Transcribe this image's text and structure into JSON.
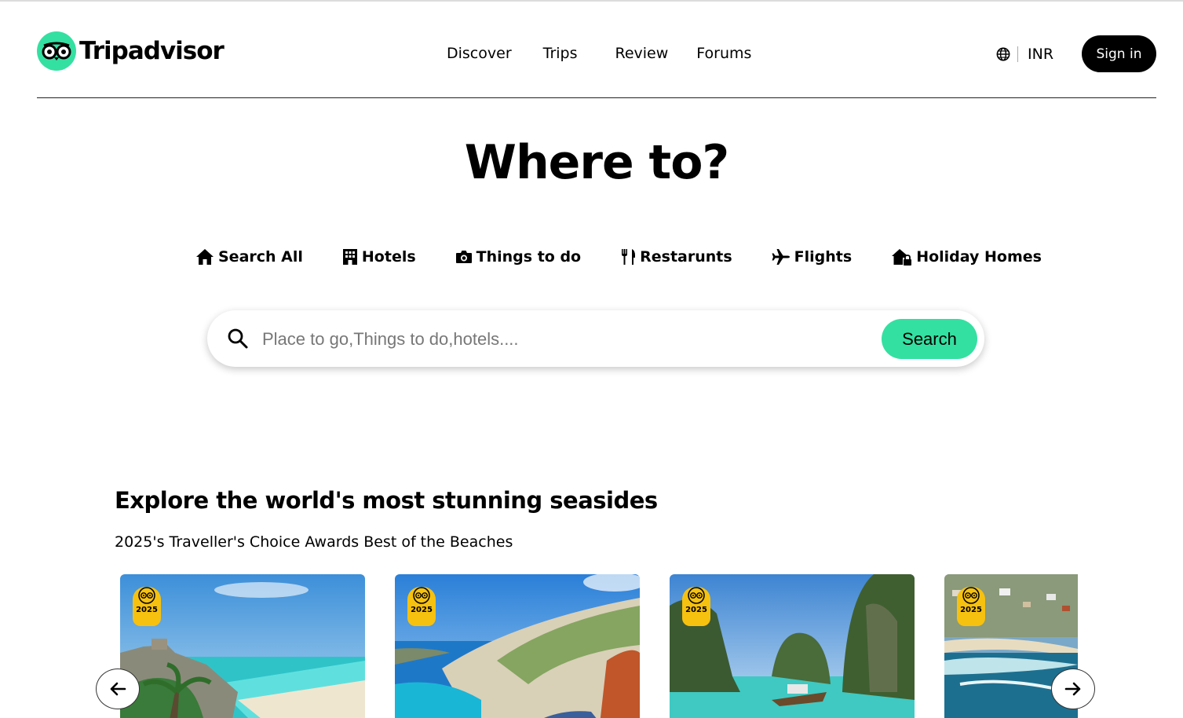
{
  "header": {
    "logo_text": "Tripadvisor",
    "nav": [
      "Discover",
      "Trips",
      "Review",
      "Forums"
    ],
    "currency": "INR",
    "signin_label": "Sign in"
  },
  "hero": {
    "title": "Where to?",
    "tabs": [
      {
        "label": "Search All",
        "icon": "home-icon"
      },
      {
        "label": "Hotels",
        "icon": "hotel-icon"
      },
      {
        "label": "Things to do",
        "icon": "camera-icon"
      },
      {
        "label": "Restarunts",
        "icon": "utensils-icon"
      },
      {
        "label": "Flights",
        "icon": "plane-icon"
      },
      {
        "label": "Holiday Homes",
        "icon": "house-lock-icon"
      }
    ],
    "search_placeholder": "Place to go,Things to do,hotels....",
    "search_button": "Search"
  },
  "section": {
    "title": "Explore the world's most stunning seasides",
    "subtitle": "2025's Traveller's Choice Awards Best of the Beaches",
    "cards": [
      {
        "badge_year": "2025"
      },
      {
        "badge_year": "2025"
      },
      {
        "badge_year": "2025"
      },
      {
        "badge_year": "2025"
      }
    ]
  },
  "colors": {
    "brand_green": "#34e0a1",
    "badge_yellow": "#f6c10f"
  }
}
